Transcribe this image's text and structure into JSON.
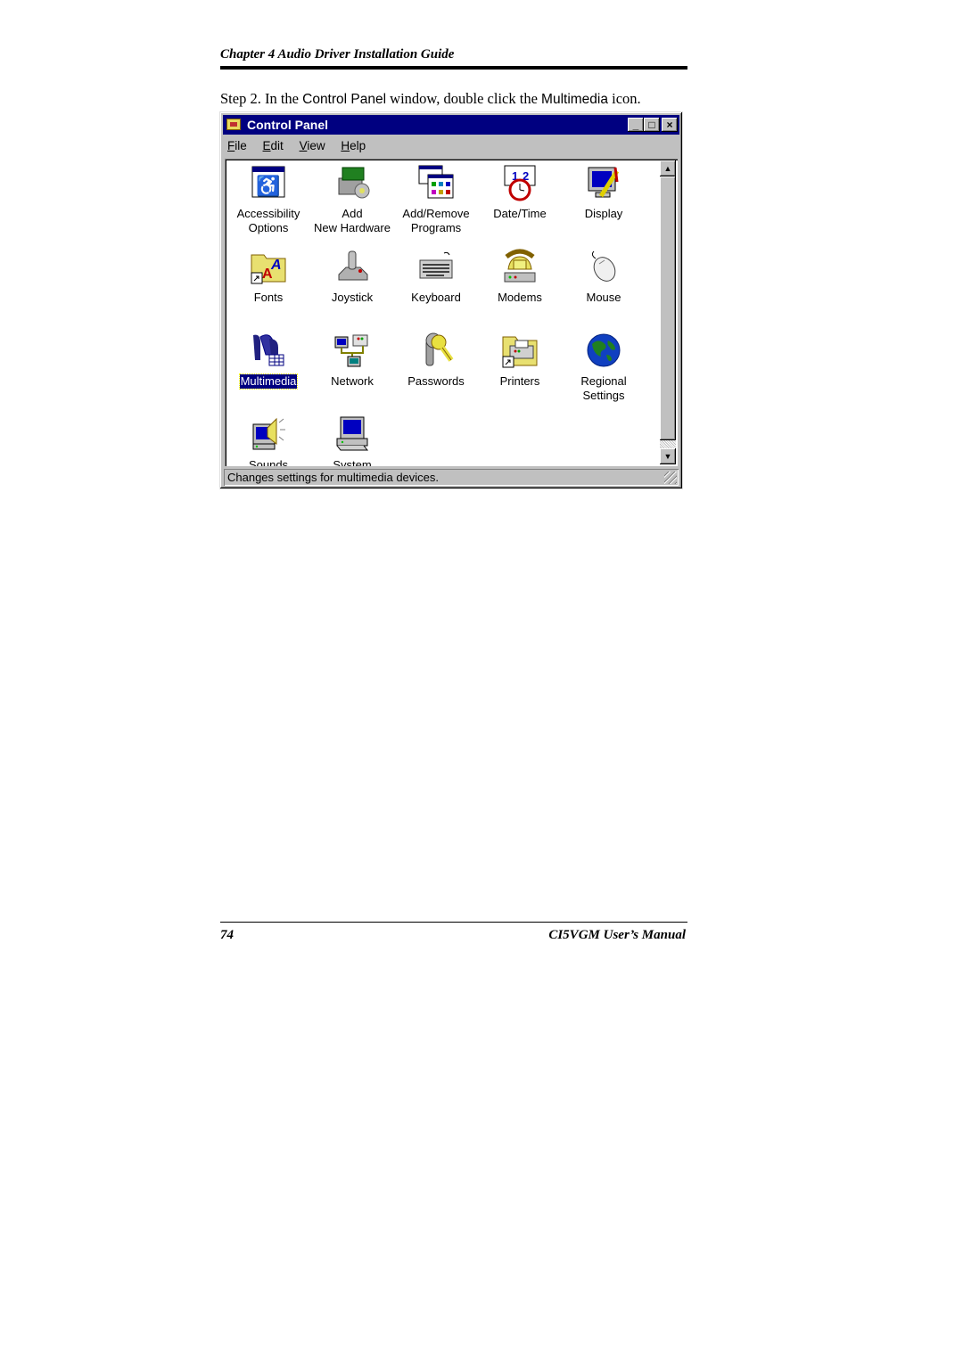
{
  "header": {
    "chapter_title": "Chapter 4  Audio Driver Installation Guide"
  },
  "step": {
    "prefix": "Step 2.  In the ",
    "window_name": "Control Panel",
    "middle": " window, double click the ",
    "icon_name": "Multimedia",
    "suffix": " icon."
  },
  "window": {
    "title": "Control Panel",
    "buttons": {
      "minimize": "_",
      "maximize": "□",
      "close": "×"
    },
    "menu": [
      {
        "accel": "F",
        "rest": "ile"
      },
      {
        "accel": "E",
        "rest": "dit"
      },
      {
        "accel": "V",
        "rest": "iew"
      },
      {
        "accel": "H",
        "rest": "elp"
      }
    ],
    "items": [
      {
        "label": "Accessibility Options",
        "icon": "accessibility-icon"
      },
      {
        "label": "Add New Hardware",
        "icon": "hardware-icon"
      },
      {
        "label": "Add/Remove Programs",
        "icon": "programs-icon"
      },
      {
        "label": "Date/Time",
        "icon": "clock-icon"
      },
      {
        "label": "Display",
        "icon": "monitor-icon"
      },
      {
        "label": "Fonts",
        "icon": "fonts-folder-icon"
      },
      {
        "label": "Joystick",
        "icon": "joystick-icon"
      },
      {
        "label": "Keyboard",
        "icon": "keyboard-icon"
      },
      {
        "label": "Modems",
        "icon": "telephone-icon"
      },
      {
        "label": "Mouse",
        "icon": "mouse-icon"
      },
      {
        "label": "Multimedia",
        "icon": "multimedia-icon",
        "selected": true
      },
      {
        "label": "Network",
        "icon": "network-icon"
      },
      {
        "label": "Passwords",
        "icon": "keys-icon"
      },
      {
        "label": "Printers",
        "icon": "printer-folder-icon"
      },
      {
        "label": "Regional Settings",
        "icon": "globe-icon"
      },
      {
        "label": "Sounds",
        "icon": "speaker-icon"
      },
      {
        "label": "System",
        "icon": "computer-icon"
      }
    ],
    "status_text": "Changes settings for multimedia devices."
  },
  "footer": {
    "page_number": "74",
    "manual_title": "CI5VGM User’s Manual"
  }
}
